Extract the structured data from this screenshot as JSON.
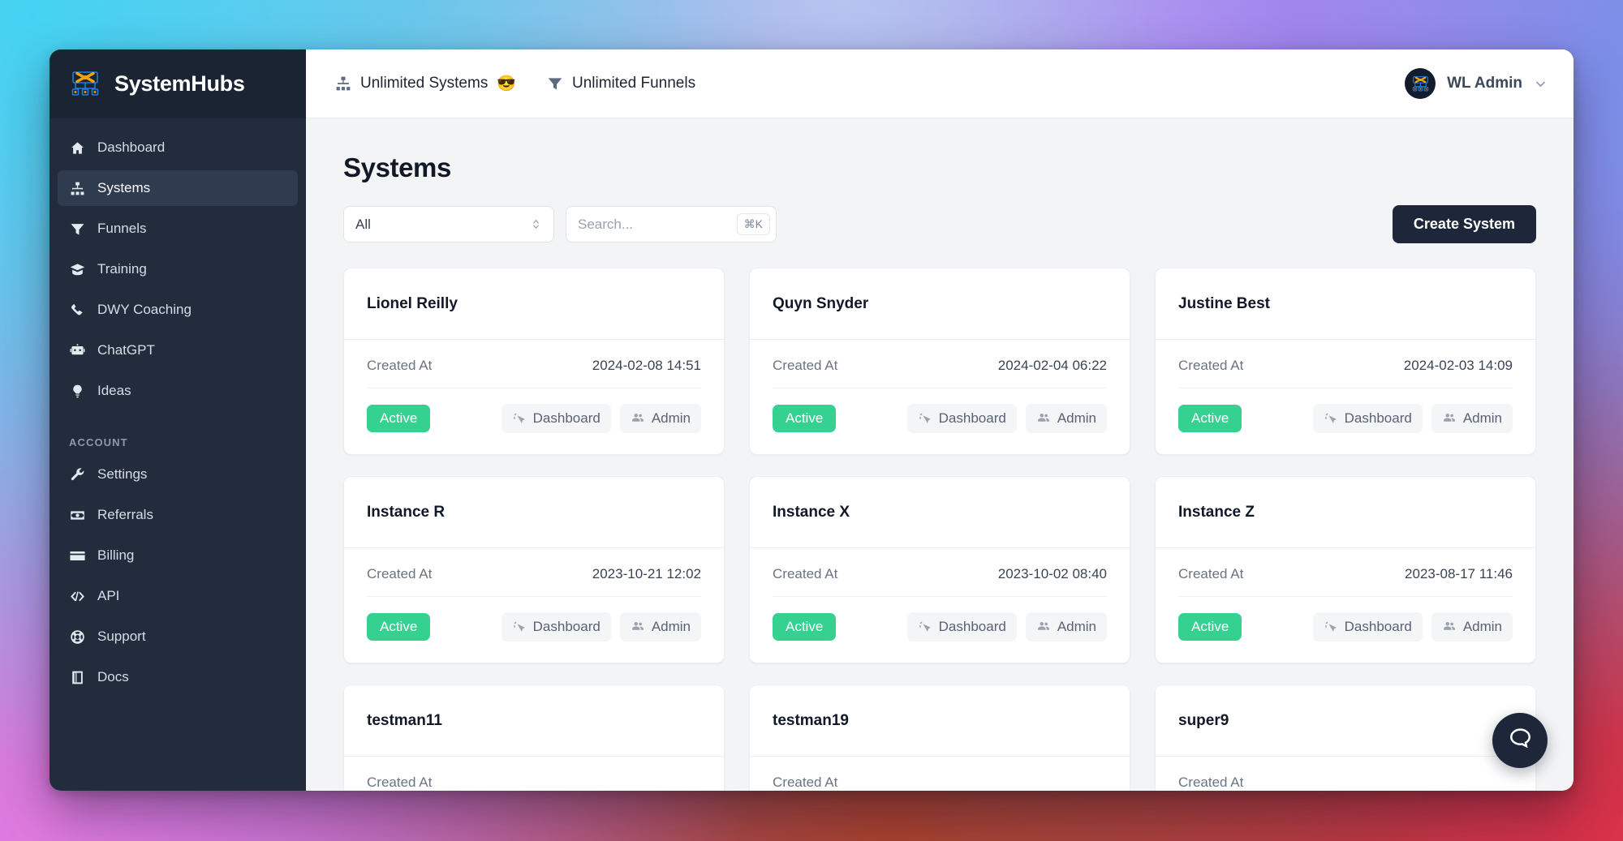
{
  "brand": {
    "name": "SystemHubs",
    "logo_icon": "systemhubs-logo-icon"
  },
  "sidebar": {
    "items": [
      {
        "label": "Dashboard",
        "icon": "home-icon",
        "active": false
      },
      {
        "label": "Systems",
        "icon": "sitemap-icon",
        "active": true
      },
      {
        "label": "Funnels",
        "icon": "funnel-icon",
        "active": false
      },
      {
        "label": "Training",
        "icon": "graduation-cap-icon",
        "active": false
      },
      {
        "label": "DWY Coaching",
        "icon": "phone-icon",
        "active": false
      },
      {
        "label": "ChatGPT",
        "icon": "robot-icon",
        "active": false
      },
      {
        "label": "Ideas",
        "icon": "lightbulb-icon",
        "active": false
      }
    ],
    "account_section_label": "ACCOUNT",
    "account_items": [
      {
        "label": "Settings",
        "icon": "wrench-icon"
      },
      {
        "label": "Referrals",
        "icon": "money-bill-icon"
      },
      {
        "label": "Billing",
        "icon": "credit-card-icon"
      },
      {
        "label": "API",
        "icon": "code-brackets-icon"
      },
      {
        "label": "Support",
        "icon": "life-ring-icon"
      },
      {
        "label": "Docs",
        "icon": "book-icon"
      }
    ]
  },
  "topbar": {
    "quotas": [
      {
        "label": "Unlimited Systems",
        "icon": "sitemap-icon",
        "emoji": "😎"
      },
      {
        "label": "Unlimited Funnels",
        "icon": "funnel-icon",
        "emoji": ""
      }
    ],
    "user": {
      "name": "WL Admin",
      "avatar_icon": "systemhubs-logo-icon",
      "chevron_icon": "chevron-down-icon"
    }
  },
  "page": {
    "title": "Systems",
    "filter": {
      "value": "All",
      "icon": "up-down-chevrons-icon"
    },
    "search": {
      "value": "",
      "placeholder": "Search...",
      "shortcut": "⌘K"
    },
    "create_button": "Create System"
  },
  "card_labels": {
    "created_at": "Created At",
    "status": "Active",
    "dashboard": "Dashboard",
    "admin": "Admin",
    "dashboard_icon": "cursor-click-icon",
    "admin_icon": "users-group-icon"
  },
  "systems": [
    {
      "name": "Lionel Reilly",
      "created_at": "2024-02-08 14:51",
      "status": "Active"
    },
    {
      "name": "Quyn Snyder",
      "created_at": "2024-02-04 06:22",
      "status": "Active"
    },
    {
      "name": "Justine Best",
      "created_at": "2024-02-03 14:09",
      "status": "Active"
    },
    {
      "name": "Instance R",
      "created_at": "2023-10-21 12:02",
      "status": "Active"
    },
    {
      "name": "Instance X",
      "created_at": "2023-10-02 08:40",
      "status": "Active"
    },
    {
      "name": "Instance Z",
      "created_at": "2023-08-17 11:46",
      "status": "Active"
    },
    {
      "name": "testman11",
      "created_at": "",
      "status": ""
    },
    {
      "name": "testman19",
      "created_at": "",
      "status": ""
    },
    {
      "name": "super9",
      "created_at": "",
      "status": ""
    }
  ],
  "chat_widget": {
    "icon": "chat-bubble-icon"
  },
  "colors": {
    "sidebar_bg": "#222c3c",
    "sidebar_brand_bg": "#1a2433",
    "sidebar_active": "#2f3b4e",
    "main_bg": "#f2f4f6",
    "accent_dark": "#1d2739",
    "status_active": "#35d191",
    "ghost_btn_bg": "#f4f5f7"
  }
}
